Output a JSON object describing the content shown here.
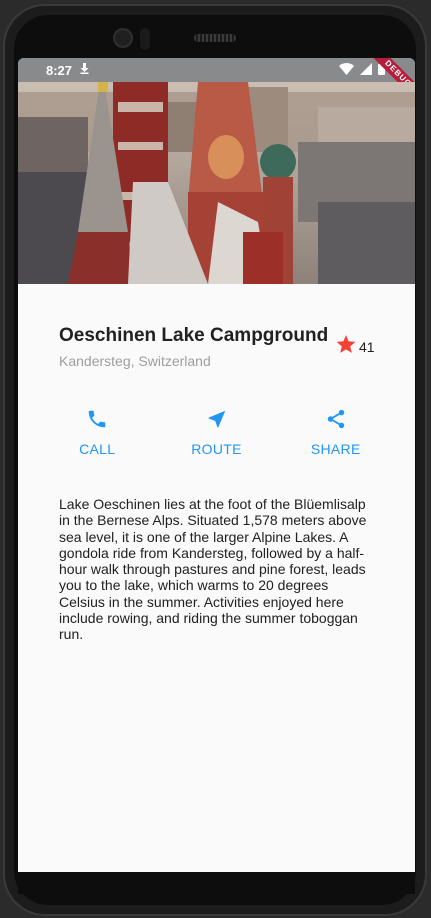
{
  "status": {
    "time": "8:27",
    "debug_banner": "DEBUG"
  },
  "place": {
    "title": "Oeschinen Lake Campground",
    "location": "Kandersteg, Switzerland",
    "rating_count": "41",
    "rating_color": "#f44336"
  },
  "actions": [
    {
      "label": "CALL",
      "icon": "phone-icon"
    },
    {
      "label": "ROUTE",
      "icon": "near-me-icon"
    },
    {
      "label": "SHARE",
      "icon": "share-icon"
    }
  ],
  "description": "Lake Oeschinen lies at the foot of the Blüemlisalp in the Bernese Alps. Situated 1,578 meters above sea level, it is one of the larger Alpine Lakes. A gondola ride from Kandersteg, followed by a half-hour walk through pastures and pine forest, leads you to the lake, which warms to 20 degrees Celsius in the summer. Activities enjoyed here include rowing, and riding the summer toboggan run.",
  "accent_color": "#2196f3"
}
